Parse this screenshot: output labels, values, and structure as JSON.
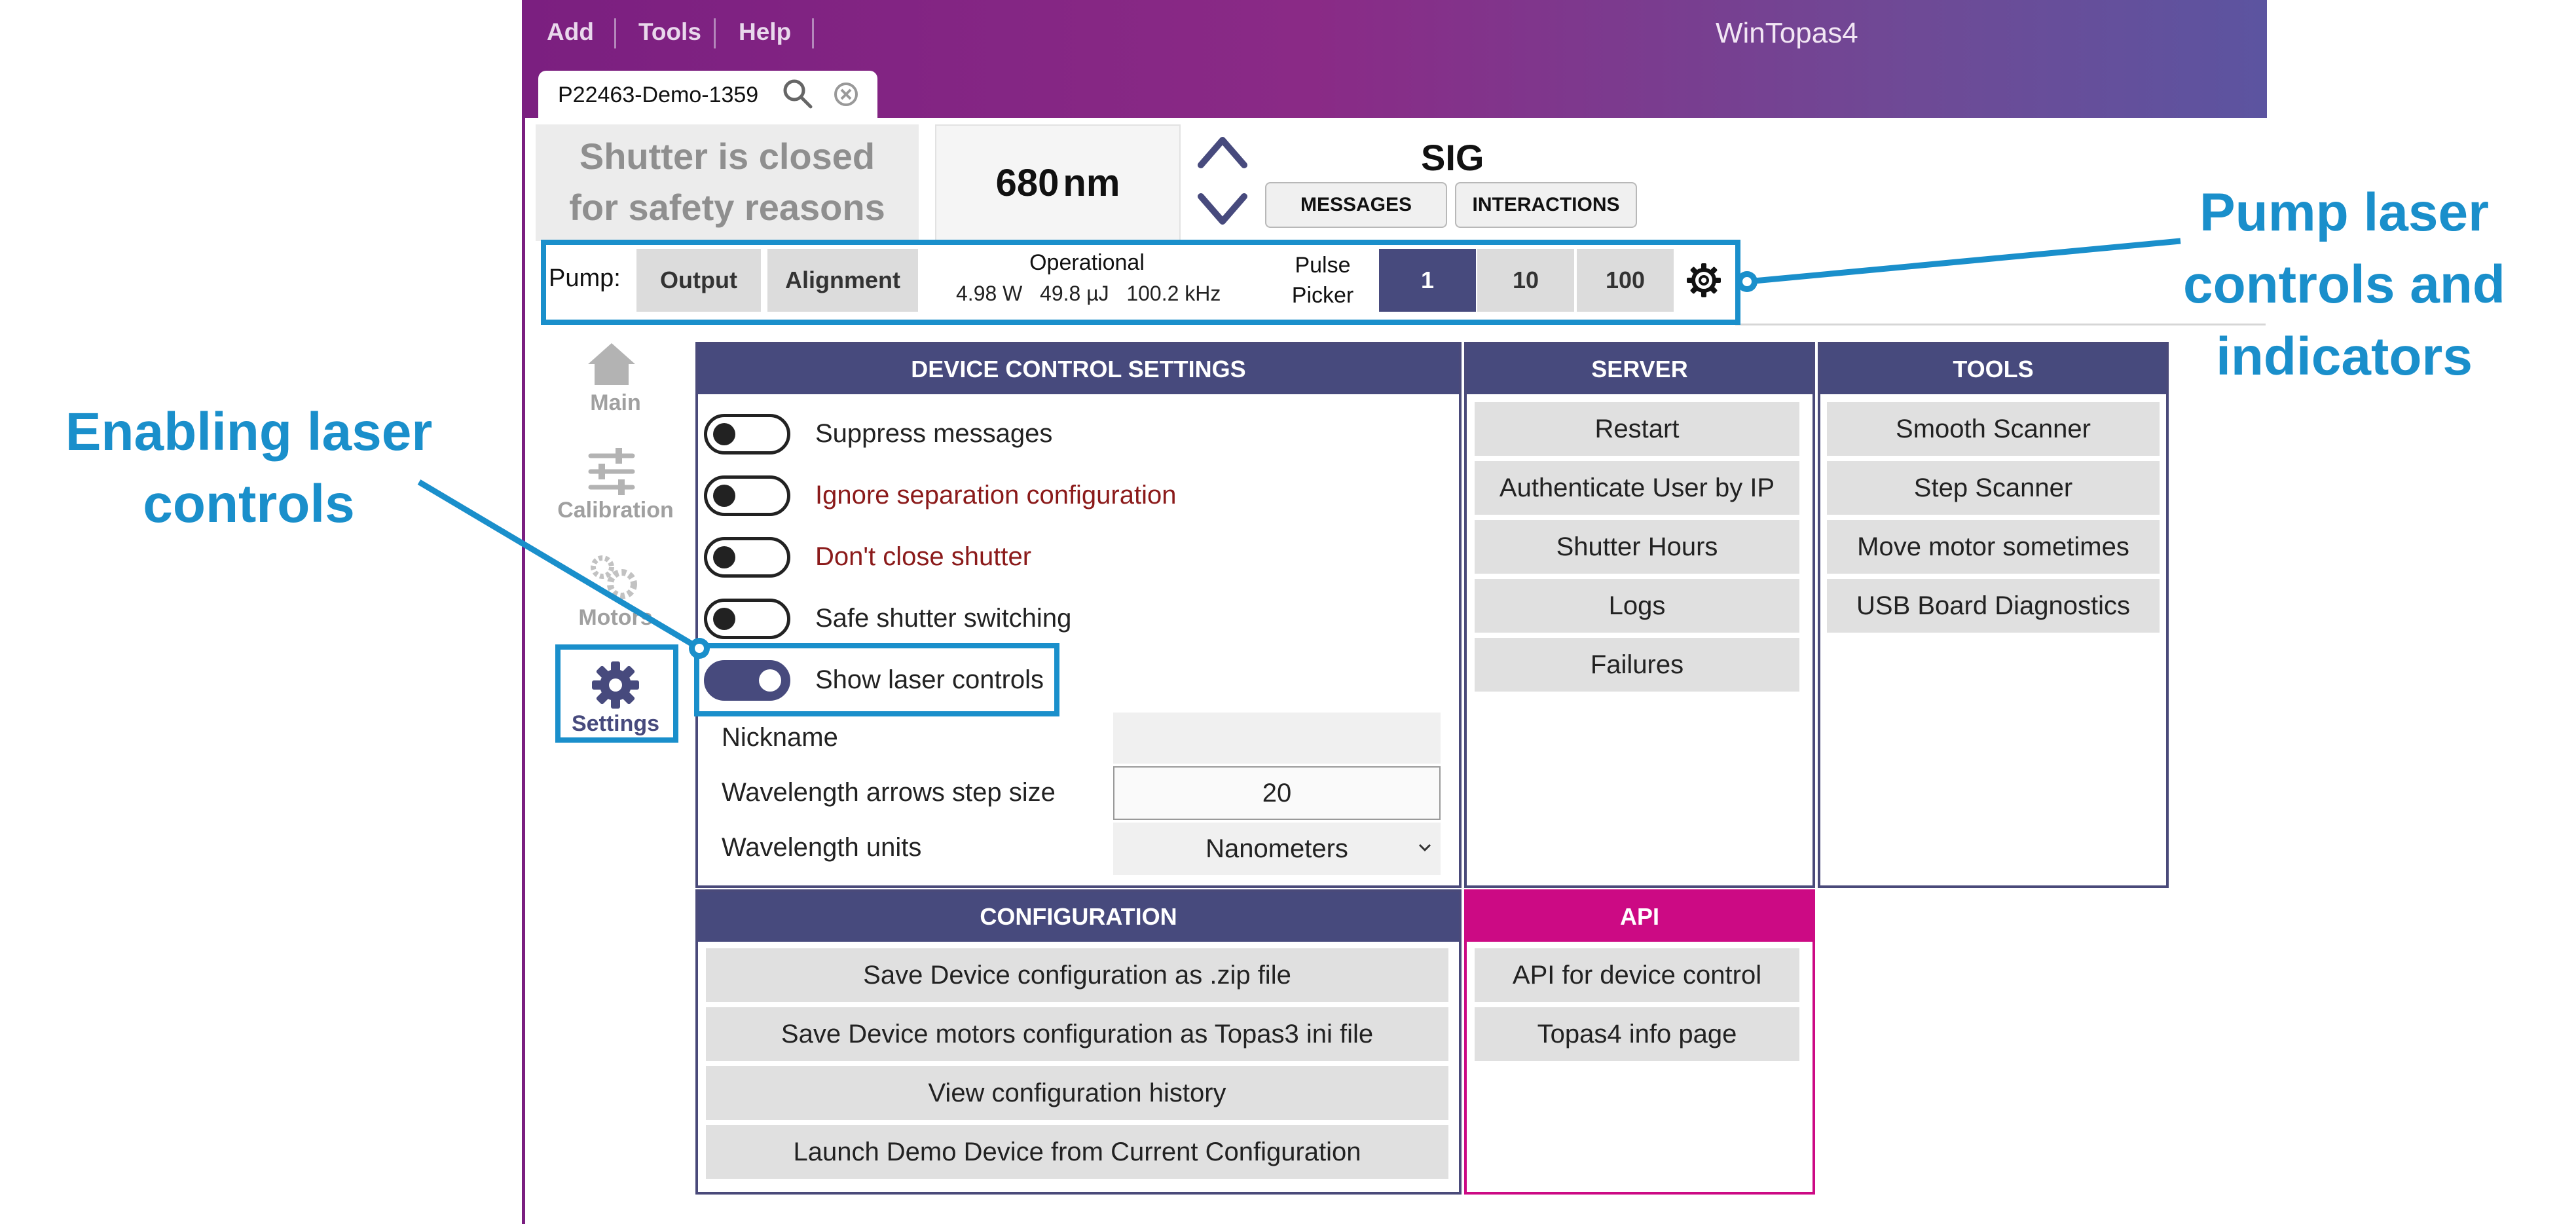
{
  "window": {
    "title": "WinTopas4",
    "menu": [
      "Add",
      "Tools",
      "Help"
    ],
    "tab": {
      "label": "P22463-Demo-1359"
    }
  },
  "status": {
    "shutter_line1": "Shutter is closed",
    "shutter_line2": "for safety reasons",
    "wavelength_value": "680",
    "wavelength_unit": "nm",
    "output_name": "SIG",
    "messages_label": "MESSAGES",
    "interactions_label": "INTERACTIONS"
  },
  "pump": {
    "label": "Pump:",
    "output_label": "Output",
    "alignment_label": "Alignment",
    "state": "Operational",
    "power": "4.98 W",
    "energy": "49.8 µJ",
    "frequency": "100.2 kHz",
    "pulse_picker_line1": "Pulse",
    "pulse_picker_line2": "Picker",
    "picker_options": [
      "1",
      "10",
      "100"
    ],
    "picker_selected": "1"
  },
  "nav": {
    "items": [
      {
        "label": "Main",
        "icon": "home-icon"
      },
      {
        "label": "Calibration",
        "icon": "sliders-icon"
      },
      {
        "label": "Motors",
        "icon": "gears-icon"
      },
      {
        "label": "Settings",
        "icon": "gear-icon"
      }
    ],
    "active": "Settings"
  },
  "device_control": {
    "header": "DEVICE CONTROL SETTINGS",
    "toggles": [
      {
        "label": "Suppress messages",
        "on": false,
        "warning": false
      },
      {
        "label": "Ignore separation configuration",
        "on": false,
        "warning": true
      },
      {
        "label": "Don't close shutter",
        "on": false,
        "warning": true
      },
      {
        "label": "Safe shutter switching",
        "on": false,
        "warning": false
      },
      {
        "label": "Show laser controls",
        "on": true,
        "warning": false
      }
    ],
    "nickname_label": "Nickname",
    "nickname_value": "",
    "step_label": "Wavelength arrows step size",
    "step_value": "20",
    "units_label": "Wavelength units",
    "units_value": "Nanometers"
  },
  "server": {
    "header": "SERVER",
    "buttons": [
      "Restart",
      "Authenticate User by IP",
      "Shutter Hours",
      "Logs",
      "Failures"
    ]
  },
  "tools": {
    "header": "TOOLS",
    "buttons": [
      "Smooth Scanner",
      "Step Scanner",
      "Move motor sometimes",
      "USB Board Diagnostics"
    ]
  },
  "configuration": {
    "header": "CONFIGURATION",
    "buttons": [
      "Save Device configuration as .zip file",
      "Save Device motors configuration as Topas3 ini file",
      "View configuration history",
      "Launch Demo Device from Current Configuration"
    ]
  },
  "api": {
    "header": "API",
    "buttons": [
      "API for device control",
      "Topas4 info page"
    ]
  },
  "annotations": {
    "pump_line1": "Pump laser",
    "pump_line2": "controls and",
    "pump_line3": "indicators",
    "enable_line1": "Enabling laser",
    "enable_line2": "controls"
  },
  "colors": {
    "accent": "#474a7d",
    "title_bar": "#7b1f80",
    "annotation": "#1a8fcb",
    "api_header": "#cc0a84",
    "warning_text": "#8b1a1a"
  }
}
